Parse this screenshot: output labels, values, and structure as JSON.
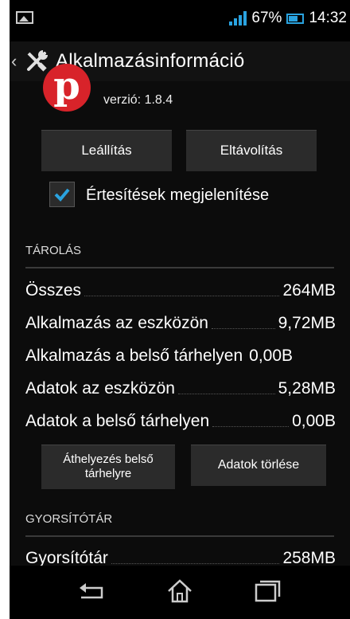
{
  "status": {
    "battery_pct": "67%",
    "time": "14:32"
  },
  "header": {
    "title": "Alkalmazásinformáció"
  },
  "app": {
    "version": "verzió: 1.8.4",
    "logo_letter": "p"
  },
  "buttons": {
    "stop": "Leállítás",
    "uninstall": "Eltávolítás",
    "move": "Áthelyezés belső tárhelyre",
    "clear_data": "Adatok törlése"
  },
  "notifications": {
    "label": "Értesítések megjelenítése",
    "checked": true
  },
  "storage": {
    "section_title": "TÁROLÁS",
    "rows": [
      {
        "label": "Összes",
        "value": "264MB"
      },
      {
        "label": "Alkalmazás az eszközön",
        "value": "9,72MB"
      },
      {
        "label": "Alkalmazás a belső tárhelyen",
        "value": "0,00B"
      },
      {
        "label": "Adatok az eszközön",
        "value": "5,28MB"
      },
      {
        "label": "Adatok a belső tárhelyen",
        "value": "0,00B"
      }
    ]
  },
  "cache": {
    "section_title": "GYORSÍTÓTÁR",
    "rows": [
      {
        "label": "Gyorsítótár",
        "value": "258MB"
      }
    ]
  },
  "colors": {
    "accent": "#2aa3e0",
    "pinterest_red": "#d8232a"
  }
}
